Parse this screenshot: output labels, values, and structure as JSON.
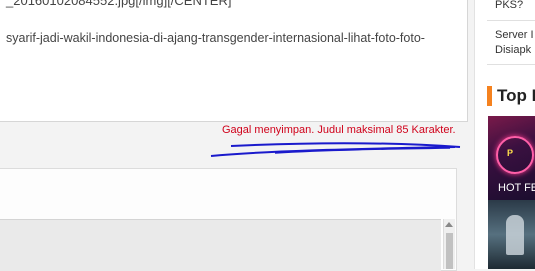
{
  "editor": {
    "line1": "_20160102084552.jpg[/img][/CENTER]",
    "line2": "syarif-jadi-wakil-indonesia-di-ajang-transgender-internasional-lihat-foto-foto-"
  },
  "error_message": "Gagal menyimpan. Judul maksimal 85 Karakter.",
  "sidebar": {
    "items": [
      {
        "text": "PKS?"
      },
      {
        "text": "Server I"
      },
      {
        "text": "Disiapk"
      }
    ],
    "section_title": "Top I",
    "thumb1_caption": "HOT FE",
    "thumb1_sign": "P"
  },
  "colors": {
    "error": "#d0021b",
    "accent": "#f5821f",
    "scribble": "#1a1acc"
  }
}
